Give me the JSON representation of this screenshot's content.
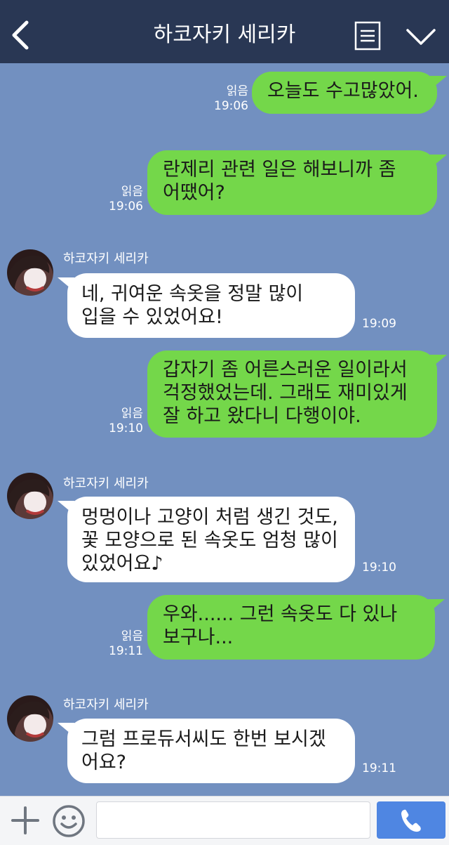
{
  "header": {
    "title": "하코자키 세리카"
  },
  "messages": [
    {
      "direction": "out",
      "lines": [
        "오늘도 수고많았어."
      ],
      "read": "읽음",
      "time": "19:06"
    },
    {
      "direction": "out",
      "lines": [
        "란제리 관련 일은 해보니까 좀",
        "어땠어?"
      ],
      "read": "읽음",
      "time": "19:06"
    },
    {
      "direction": "in",
      "sender": "하코자키 세리카",
      "lines": [
        "네, 귀여운 속옷을 정말 많이",
        "입을 수 있었어요!"
      ],
      "time": "19:09"
    },
    {
      "direction": "out",
      "lines": [
        "갑자기 좀 어른스러운 일이라서",
        "걱정했었는데. 그래도 재미있게",
        "잘 하고 왔다니 다행이야."
      ],
      "read": "읽음",
      "time": "19:10"
    },
    {
      "direction": "in",
      "sender": "하코자키 세리카",
      "lines": [
        "멍멍이나 고양이 처럼 생긴 것도,",
        "꽃 모양으로 된 속옷도 엄청 많이",
        "있었어요♪"
      ],
      "time": "19:10"
    },
    {
      "direction": "out",
      "lines": [
        "우와...... 그런 속옷도 다 있나",
        "보구나..."
      ],
      "read": "읽음",
      "time": "19:11"
    },
    {
      "direction": "in",
      "sender": "하코자키 세리카",
      "lines": [
        "그럼 프로듀서씨도 한번 보시겠",
        "어요?"
      ],
      "time": "19:11"
    }
  ],
  "footer": {
    "input_value": "",
    "input_placeholder": ""
  },
  "colors": {
    "header_bg": "#293754",
    "chat_bg": "#7290c0",
    "outgoing_bubble": "#74d74a",
    "incoming_bubble": "#ffffff",
    "send_button": "#4f86e2"
  },
  "icons": [
    "back-arrow-icon",
    "menu-icon",
    "chevron-down-icon",
    "plus-icon",
    "emoji-icon",
    "phone-icon"
  ]
}
